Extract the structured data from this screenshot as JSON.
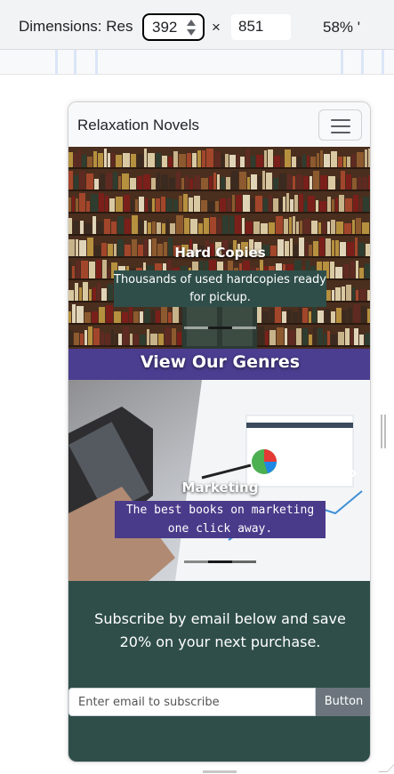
{
  "devtools": {
    "dimensions_label": "Dimensions: Res",
    "width_value": "392",
    "times": "×",
    "height_value": "851",
    "zoom": "58% '"
  },
  "site": {
    "brand": "Relaxation Novels"
  },
  "hero": {
    "title": "Hard Copies",
    "caption": "Thousands of used hardcopies ready for pickup."
  },
  "genres": {
    "heading": "View Our Genres",
    "slide_title": "Marketing",
    "slide_caption": "The best books on marketing one click away."
  },
  "subscribe": {
    "text": "Subscribe by email below and save 20% on your next purchase.",
    "placeholder": "Enter email to subscribe",
    "button": "Button"
  },
  "colors": {
    "accent_purple": "#4b3d8f",
    "dark_teal": "#2f4e4a"
  }
}
